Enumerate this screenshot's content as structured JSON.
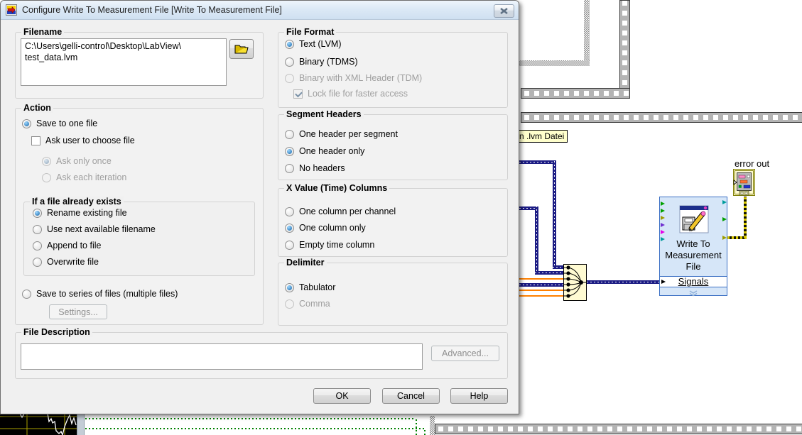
{
  "dialog": {
    "title": "Configure Write To Measurement File [Write To Measurement File]",
    "filename": {
      "group_label": "Filename",
      "value": "C:\\Users\\gelli-control\\Desktop\\LabView\\\ntest_data.lvm"
    },
    "action": {
      "group_label": "Action",
      "save_to_one_file": "Save to one file",
      "ask_user": "Ask user to choose file",
      "ask_only_once": "Ask only once",
      "ask_each_iteration": "Ask each iteration",
      "exists": {
        "group_label": "If a file already exists",
        "rename": "Rename existing file",
        "use_next": "Use next available filename",
        "append": "Append to file",
        "overwrite": "Overwrite file"
      },
      "save_series": "Save to series of files (multiple files)",
      "settings_button": "Settings..."
    },
    "file_format": {
      "group_label": "File Format",
      "text_lvm": "Text (LVM)",
      "binary_tdms": "Binary (TDMS)",
      "binary_xml": "Binary with XML Header (TDM)",
      "lock": "Lock file for faster access"
    },
    "segment_headers": {
      "group_label": "Segment Headers",
      "per_segment": "One header per segment",
      "one_only": "One header only",
      "none": "No headers"
    },
    "x_columns": {
      "group_label": "X Value (Time) Columns",
      "per_channel": "One column per channel",
      "one_only": "One column only",
      "empty": "Empty time column"
    },
    "delimiter": {
      "group_label": "Delimiter",
      "tab": "Tabulator",
      "comma": "Comma"
    },
    "file_description": {
      "group_label": "File Description",
      "value": "",
      "advanced_button": "Advanced..."
    },
    "buttons": {
      "ok": "OK",
      "cancel": "Cancel",
      "help": "Help"
    }
  },
  "diagram": {
    "free_label": "n .lvm Datei",
    "error_out_label": "error out",
    "express_vi": {
      "line1": "Write To",
      "line2": "Measurement",
      "line3": "File",
      "input": "Signals"
    },
    "colors": {
      "dynamic_wire": "#1c1c84",
      "analog_wire": "#ff8000",
      "error_wire": "#d8c800",
      "express_fill": "#d6e6f8",
      "express_border": "#3b6fc4",
      "merge_fill": "#fffbd2"
    }
  }
}
